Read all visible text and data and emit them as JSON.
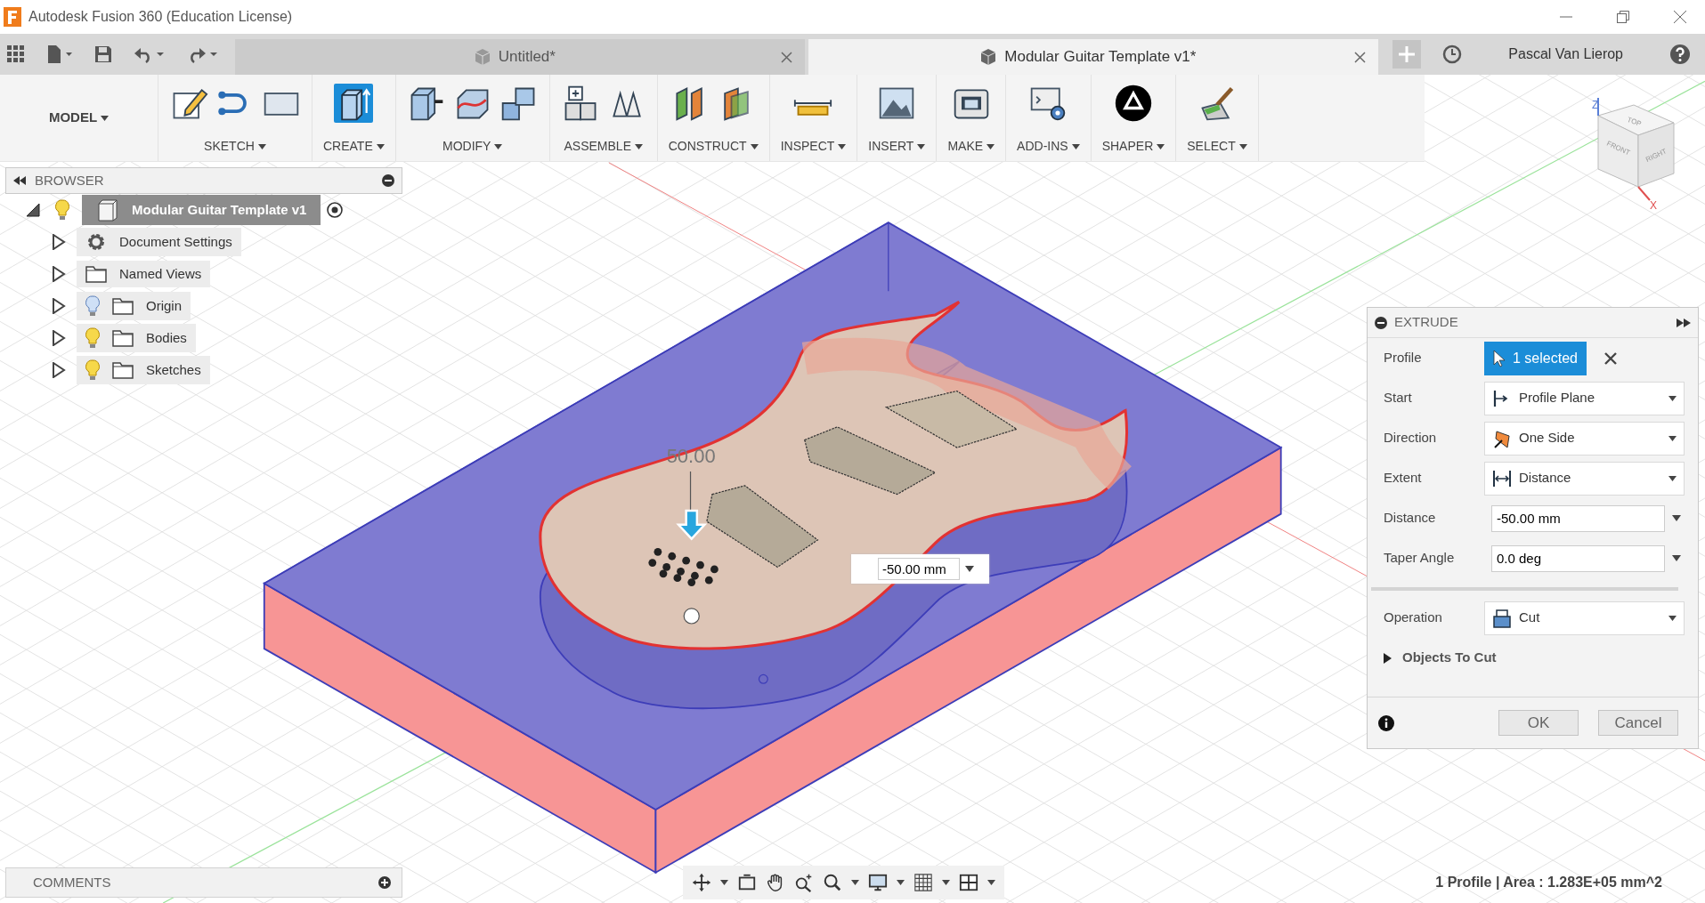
{
  "window": {
    "title": "Autodesk Fusion 360 (Education License)"
  },
  "doc_tabs": [
    {
      "label": "Untitled*",
      "selected": false
    },
    {
      "label": "Modular Guitar Template v1*",
      "selected": true
    }
  ],
  "user": {
    "name": "Pascal Van Lierop"
  },
  "workspace": {
    "label": "MODEL"
  },
  "toolbar_groups": [
    {
      "label": "SKETCH",
      "active": false
    },
    {
      "label": "CREATE",
      "active": true
    },
    {
      "label": "MODIFY",
      "active": false
    },
    {
      "label": "ASSEMBLE",
      "active": false
    },
    {
      "label": "CONSTRUCT",
      "active": false
    },
    {
      "label": "INSPECT",
      "active": false
    },
    {
      "label": "INSERT",
      "active": false
    },
    {
      "label": "MAKE",
      "active": false
    },
    {
      "label": "ADD-INS",
      "active": false
    },
    {
      "label": "SHAPER",
      "active": false
    },
    {
      "label": "SELECT",
      "active": false
    }
  ],
  "browser": {
    "title": "BROWSER",
    "root": {
      "label": "Modular Guitar Template v1",
      "expanded": true,
      "selected": true,
      "visible": true,
      "children": [
        {
          "label": "Document Settings",
          "kind": "settings",
          "expanded": false
        },
        {
          "label": "Named Views",
          "kind": "folder",
          "expanded": false
        },
        {
          "label": "Origin",
          "kind": "layer",
          "visible": false,
          "expanded": false
        },
        {
          "label": "Bodies",
          "kind": "layer",
          "visible": true,
          "expanded": false
        },
        {
          "label": "Sketches",
          "kind": "layer",
          "visible": true,
          "expanded": false
        }
      ]
    }
  },
  "viewport": {
    "dimension": "50.00",
    "distance_input": "-50.00 mm",
    "view_cube": {
      "faces": [
        "TOP",
        "FRONT",
        "RIGHT"
      ],
      "axes": [
        "Z",
        "X"
      ]
    }
  },
  "extrude": {
    "title": "EXTRUDE",
    "rows": [
      {
        "label": "Profile",
        "kind": "selection",
        "value": "1 selected"
      },
      {
        "label": "Start",
        "kind": "dropdown",
        "value": "Profile Plane"
      },
      {
        "label": "Direction",
        "kind": "dropdown",
        "value": "One Side"
      },
      {
        "label": "Extent",
        "kind": "dropdown",
        "value": "Distance"
      },
      {
        "label": "Distance",
        "kind": "input",
        "value": "-50.00 mm"
      },
      {
        "label": "Taper Angle",
        "kind": "input",
        "value": "0.0 deg"
      }
    ],
    "operation": {
      "label": "Operation",
      "value": "Cut"
    },
    "section": {
      "label": "Objects To Cut",
      "expanded": false
    },
    "buttons": [
      "OK",
      "Cancel"
    ]
  },
  "comments": {
    "title": "COMMENTS"
  },
  "status_bar": {
    "text": "1 Profile | Area : 1.283E+05 mm^2"
  }
}
